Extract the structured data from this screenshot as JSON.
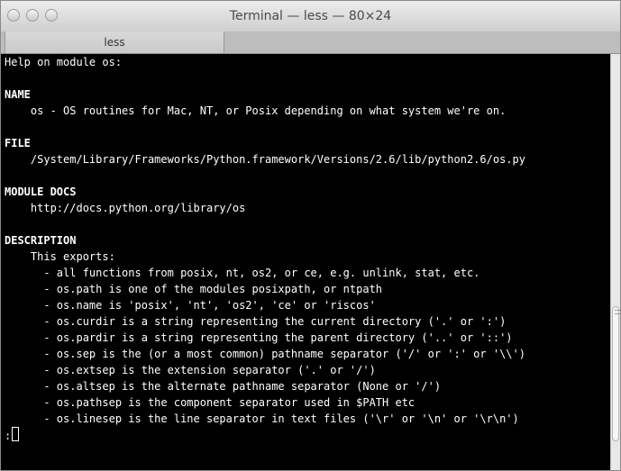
{
  "window": {
    "title": "Terminal — less — 80×24"
  },
  "tab": {
    "label": "less"
  },
  "terminal": {
    "lines": [
      {
        "text": "Help on module os:",
        "bold": false
      },
      {
        "text": "",
        "bold": false
      },
      {
        "text": "NAME",
        "bold": true
      },
      {
        "text": "    os - OS routines for Mac, NT, or Posix depending on what system we're on.",
        "bold": false
      },
      {
        "text": "",
        "bold": false
      },
      {
        "text": "FILE",
        "bold": true
      },
      {
        "text": "    /System/Library/Frameworks/Python.framework/Versions/2.6/lib/python2.6/os.py",
        "bold": false
      },
      {
        "text": "",
        "bold": false
      },
      {
        "text": "MODULE DOCS",
        "bold": true
      },
      {
        "text": "    http://docs.python.org/library/os",
        "bold": false
      },
      {
        "text": "",
        "bold": false
      },
      {
        "text": "DESCRIPTION",
        "bold": true
      },
      {
        "text": "    This exports:",
        "bold": false
      },
      {
        "text": "      - all functions from posix, nt, os2, or ce, e.g. unlink, stat, etc.",
        "bold": false
      },
      {
        "text": "      - os.path is one of the modules posixpath, or ntpath",
        "bold": false
      },
      {
        "text": "      - os.name is 'posix', 'nt', 'os2', 'ce' or 'riscos'",
        "bold": false
      },
      {
        "text": "      - os.curdir is a string representing the current directory ('.' or ':')",
        "bold": false
      },
      {
        "text": "      - os.pardir is a string representing the parent directory ('..' or '::')",
        "bold": false
      },
      {
        "text": "      - os.sep is the (or a most common) pathname separator ('/' or ':' or '\\\\')",
        "bold": false
      },
      {
        "text": "      - os.extsep is the extension separator ('.' or '/')",
        "bold": false
      },
      {
        "text": "      - os.altsep is the alternate pathname separator (None or '/')",
        "bold": false
      },
      {
        "text": "      - os.pathsep is the component separator used in $PATH etc",
        "bold": false
      },
      {
        "text": "      - os.linesep is the line separator in text files ('\\r' or '\\n' or '\\r\\n')",
        "bold": false
      }
    ],
    "prompt": ":"
  }
}
